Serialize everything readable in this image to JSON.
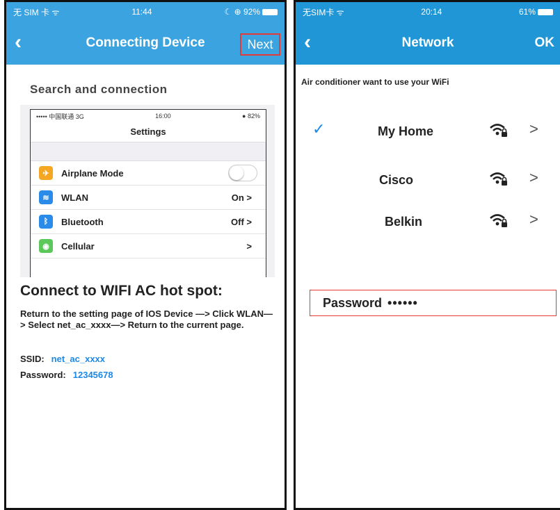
{
  "left": {
    "status": {
      "carrier": "无 SIM 卡 ᯤ",
      "time": "11:44",
      "battery": "☾ ⊕ 92%"
    },
    "nav": {
      "back": "‹",
      "title": "Connecting Device",
      "next": "Next"
    },
    "section_title": "Search and connection",
    "screenshot": {
      "status_left": "••••• 中国联通 3G",
      "status_time": "16:00",
      "status_right": "● 82%",
      "title": "Settings",
      "rows": [
        {
          "label": "Airplane Mode",
          "value": "",
          "icon_color": "#f5a623",
          "icon": "✈"
        },
        {
          "label": "WLAN",
          "value": "On >",
          "icon_color": "#2a8be8",
          "icon": "≋"
        },
        {
          "label": "Bluetooth",
          "value": "Off >",
          "icon_color": "#2a8be8",
          "icon": "ᛒ"
        },
        {
          "label": "Cellular",
          "value": ">",
          "icon_color": "#5cc85a",
          "icon": "◉"
        }
      ]
    },
    "heading": "Connect to WIFI AC hot spot:",
    "instructions": "Return to the setting page of IOS Device —> Click WLAN—> Select net_ac_xxxx—> Return to the current page.",
    "ssid_label": "SSID:",
    "ssid_value": "net_ac_xxxx",
    "password_label": "Password:",
    "password_value": "12345678"
  },
  "right": {
    "status": {
      "carrier": "无SIM卡 ᯤ",
      "time": "20:14",
      "battery": "61%"
    },
    "nav": {
      "back": "‹",
      "title": "Network",
      "ok": "OK"
    },
    "prompt": "Air conditioner want to use your WiFi",
    "networks": [
      {
        "name": "My Home",
        "selected": true,
        "check": "✓",
        "chevron": ">"
      },
      {
        "name": "Cisco",
        "selected": false,
        "check": "",
        "chevron": ">"
      },
      {
        "name": "Belkin",
        "selected": false,
        "check": "",
        "chevron": ">"
      }
    ],
    "password_label": "Password",
    "password_mask": "••••••"
  },
  "colors": {
    "nav_left": "#3aa3e0",
    "nav_right": "#2196d6",
    "highlight": "#e53935",
    "link": "#1e88e5"
  }
}
